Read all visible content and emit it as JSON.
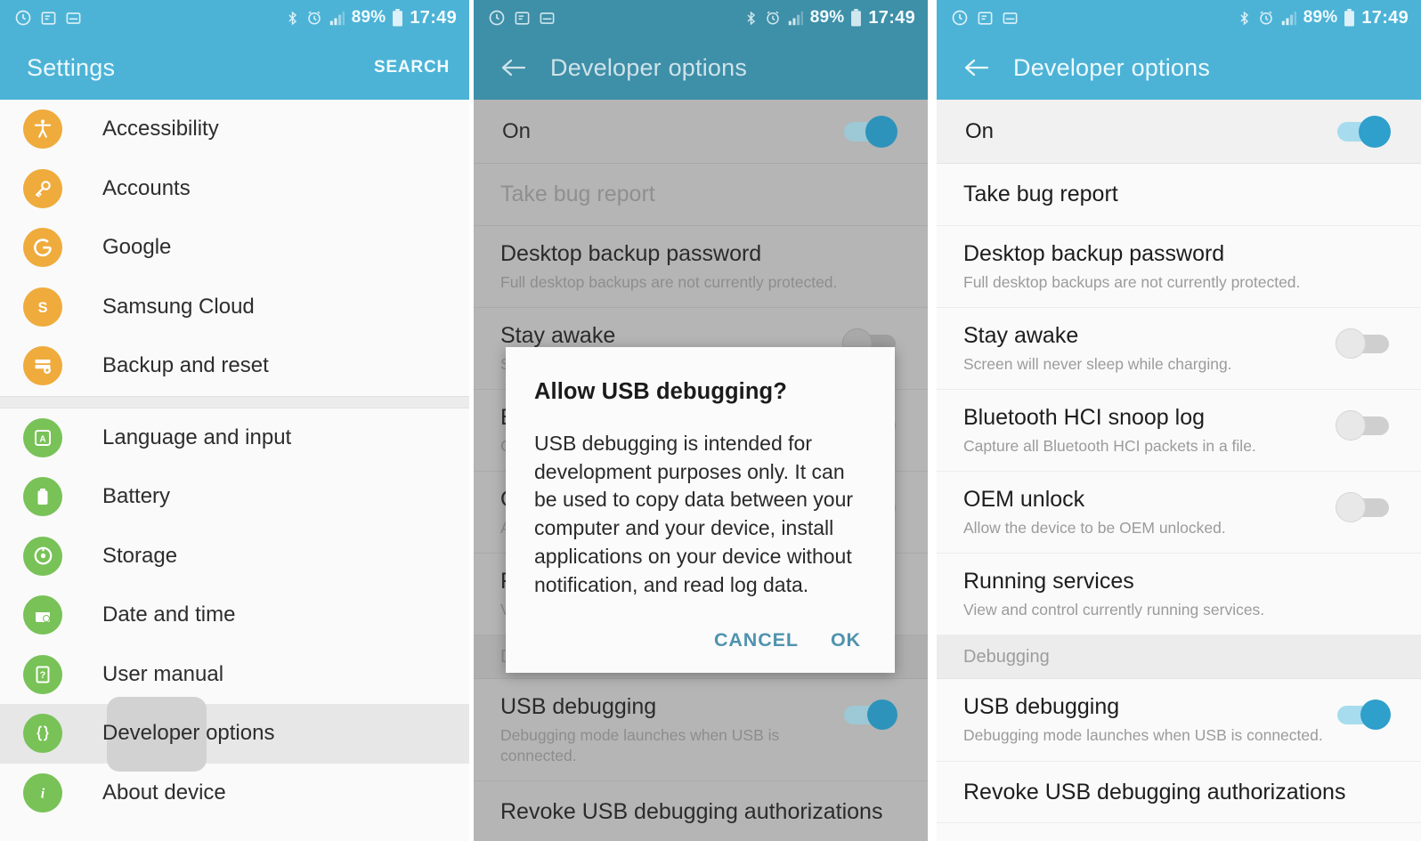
{
  "status_bar": {
    "notification_icons": [
      "sync-icon",
      "note-icon",
      "screenshot-icon"
    ],
    "bluetooth": "bluetooth-icon",
    "alarm": "alarm-icon",
    "signal": "signal-icon",
    "battery_percent": "89%",
    "battery": "battery-icon",
    "time": "17:49"
  },
  "colors": {
    "appbar": "#4cb3d6",
    "appbar_dimmed": "#3e8fa8",
    "icon_amber": "#efab3c",
    "icon_green": "#78c257",
    "toggle_on_knob": "#2f9fcc",
    "toggle_on_track": "#a6dcee",
    "dialog_button": "#4f93ae"
  },
  "panel1": {
    "appbar": {
      "title": "Settings",
      "action": "SEARCH"
    },
    "groups": [
      {
        "items": [
          {
            "label": "Accessibility",
            "icon": "accessibility-icon",
            "color": "amber"
          },
          {
            "label": "Accounts",
            "icon": "key-icon",
            "color": "amber"
          },
          {
            "label": "Google",
            "icon": "google-g-icon",
            "color": "amber"
          },
          {
            "label": "Samsung Cloud",
            "icon": "samsung-s-icon",
            "color": "amber"
          },
          {
            "label": "Backup and reset",
            "icon": "backup-icon",
            "color": "amber"
          }
        ]
      },
      {
        "items": [
          {
            "label": "Language and input",
            "icon": "language-icon",
            "color": "green"
          },
          {
            "label": "Battery",
            "icon": "battery-icon",
            "color": "green"
          },
          {
            "label": "Storage",
            "icon": "storage-icon",
            "color": "green"
          },
          {
            "label": "Date and time",
            "icon": "calendar-clock-icon",
            "color": "green"
          },
          {
            "label": "User manual",
            "icon": "question-doc-icon",
            "color": "green"
          },
          {
            "label": "Developer options",
            "icon": "braces-icon",
            "color": "green",
            "selected": true
          },
          {
            "label": "About device",
            "icon": "info-icon",
            "color": "green"
          }
        ]
      }
    ]
  },
  "panel2": {
    "appbar": {
      "back": "back-arrow-icon",
      "title": "Developer options"
    },
    "master_toggle": {
      "label": "On",
      "state": "on"
    },
    "rows": [
      {
        "title": "Take bug report",
        "subtitle": "",
        "toggle": null,
        "faded": true
      },
      {
        "title": "Desktop backup password",
        "subtitle": "Full desktop backups are not currently protected.",
        "toggle": null
      },
      {
        "title": "Stay awake",
        "subtitle": "Screen will never sleep while charging.",
        "toggle": "off"
      },
      {
        "title": "Bluetooth HCI snoop log",
        "subtitle": "Capture all Bluetooth HCI packets in a file.",
        "toggle": "off"
      },
      {
        "title": "OEM unlock",
        "subtitle": "Allow the device to be OEM unlocked.",
        "toggle": "off"
      },
      {
        "title": "Running services",
        "subtitle": "View and control currently running services.",
        "toggle": null
      }
    ],
    "section_label": "Debugging",
    "debug_rows": [
      {
        "title": "USB debugging",
        "subtitle": "Debugging mode launches when USB is connected.",
        "toggle": "on"
      },
      {
        "title": "Revoke USB debugging authorizations",
        "subtitle": "",
        "toggle": null
      }
    ],
    "dialog": {
      "title": "Allow USB debugging?",
      "body": "USB debugging is intended for development purposes only. It can be used to copy data between your computer and your device, install applications on your device without notification, and read log data.",
      "cancel": "CANCEL",
      "ok": "OK"
    }
  },
  "panel3": {
    "appbar": {
      "back": "back-arrow-icon",
      "title": "Developer options"
    },
    "master_toggle": {
      "label": "On",
      "state": "on"
    },
    "rows": [
      {
        "title": "Take bug report",
        "subtitle": "",
        "toggle": null
      },
      {
        "title": "Desktop backup password",
        "subtitle": "Full desktop backups are not currently protected.",
        "toggle": null
      },
      {
        "title": "Stay awake",
        "subtitle": "Screen will never sleep while charging.",
        "toggle": "off"
      },
      {
        "title": "Bluetooth HCI snoop log",
        "subtitle": "Capture all Bluetooth HCI packets in a file.",
        "toggle": "off"
      },
      {
        "title": "OEM unlock",
        "subtitle": "Allow the device to be OEM unlocked.",
        "toggle": "off"
      },
      {
        "title": "Running services",
        "subtitle": "View and control currently running services.",
        "toggle": null
      }
    ],
    "section_label": "Debugging",
    "debug_rows": [
      {
        "title": "USB debugging",
        "subtitle": "Debugging mode launches when USB is connected.",
        "toggle": "on"
      },
      {
        "title": "Revoke USB debugging authorizations",
        "subtitle": "",
        "toggle": null
      }
    ]
  }
}
